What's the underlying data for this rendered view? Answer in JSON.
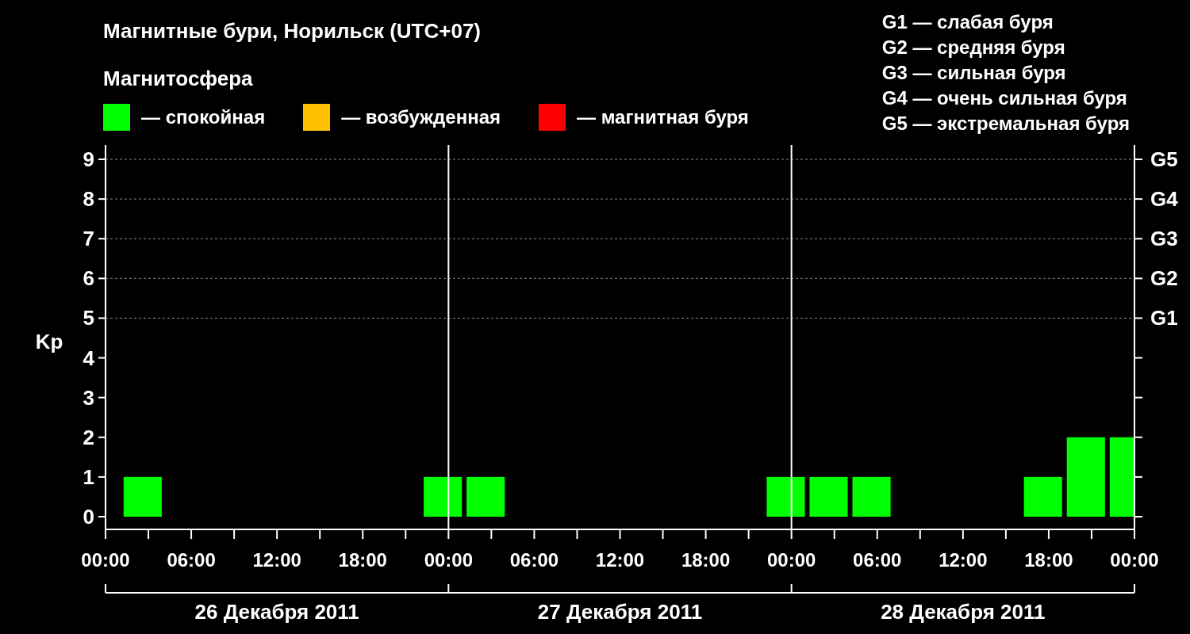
{
  "title": "Магнитные бури, Норильск (UTC+07)",
  "legend": {
    "title": "Магнитосфера",
    "items": [
      {
        "label": "— спокойная",
        "color": "#00ff00"
      },
      {
        "label": "— возбужденная",
        "color": "#ffc000"
      },
      {
        "label": "— магнитная буря",
        "color": "#ff0000"
      }
    ]
  },
  "storm_scale": [
    "G1 — слабая буря",
    "G2 — средняя буря",
    "G3 — сильная буря",
    "G4 — очень сильная буря",
    "G5 — экстремальная буря"
  ],
  "chart": {
    "chart_data": {
      "type": "bar",
      "ylabel": "Kp",
      "x": [
        "2011-12-26 02:36",
        "2011-12-26 23:36",
        "2011-12-27 02:36",
        "2011-12-27 23:36",
        "2011-12-28 02:36",
        "2011-12-28 05:36",
        "2011-12-28 17:36",
        "2011-12-28 20:36",
        "2011-12-28 23:08"
      ],
      "series": [
        {
          "color": "#00ff00",
          "values": [
            1,
            1,
            1,
            1,
            1,
            1,
            1,
            2,
            2
          ]
        }
      ],
      "xlim": [
        "2011-12-26 00:00",
        "2011-12-29 00:00"
      ],
      "ylim": [
        -0.32,
        9.36
      ],
      "xticks": [
        {
          "value": "2011-12-26 00:00",
          "label": "00:00"
        },
        {
          "value": "2011-12-26 06:00",
          "label": "06:00"
        },
        {
          "value": "2011-12-26 12:00",
          "label": "12:00"
        },
        {
          "value": "2011-12-26 18:00",
          "label": "18:00"
        },
        {
          "value": "2011-12-27 00:00",
          "label": "00:00"
        },
        {
          "value": "2011-12-27 06:00",
          "label": "06:00"
        },
        {
          "value": "2011-12-27 12:00",
          "label": "12:00"
        },
        {
          "value": "2011-12-27 18:00",
          "label": "18:00"
        },
        {
          "value": "2011-12-28 00:00",
          "label": "00:00"
        },
        {
          "value": "2011-12-28 06:00",
          "label": "06:00"
        },
        {
          "value": "2011-12-28 12:00",
          "label": "12:00"
        },
        {
          "value": "2011-12-28 18:00",
          "label": "18:00"
        },
        {
          "value": "2011-12-29 00:00",
          "label": "00:00"
        }
      ],
      "yticks": [
        0,
        1,
        2,
        3,
        4,
        5,
        6,
        7,
        8,
        9
      ],
      "grid": true
    },
    "right_ticks": [
      "G5",
      "G4",
      "G3",
      "G2",
      "G1"
    ],
    "days": [
      "26 Декабря 2011",
      "27 Декабря 2011",
      "28 Декабря 2011"
    ]
  }
}
